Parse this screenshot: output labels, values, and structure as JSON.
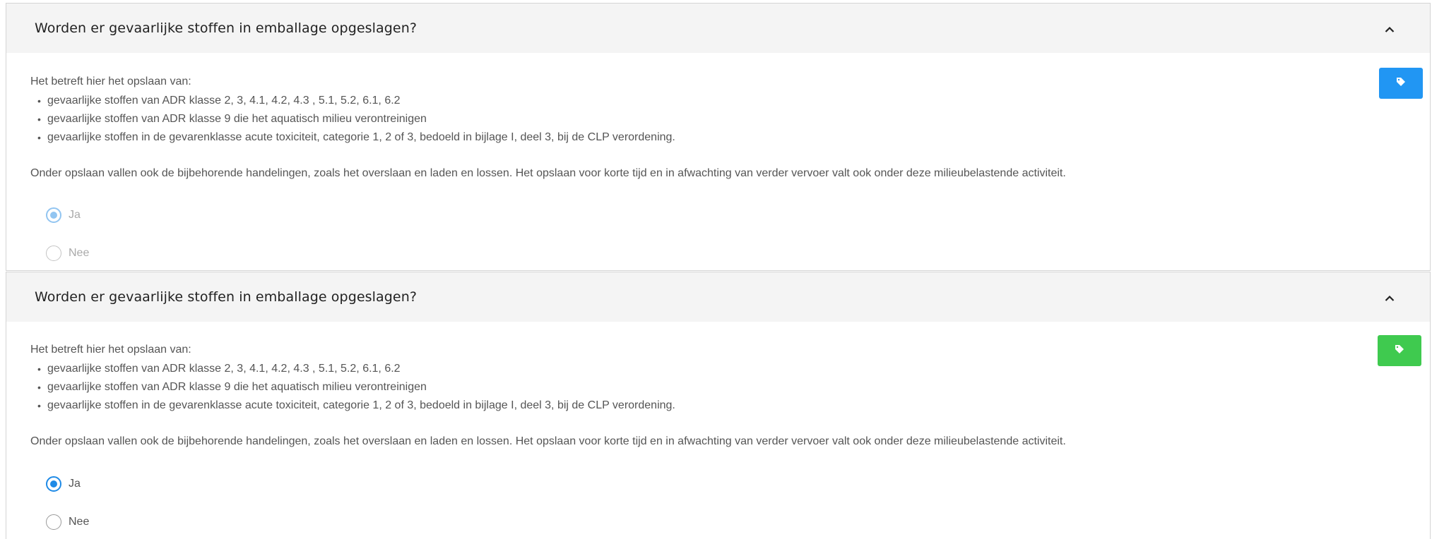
{
  "colors": {
    "tag_blue": "#2196f3",
    "tag_green": "#3fca4f",
    "radio_checked": "#1e8ae6",
    "radio_disabled_checked": "#92c5f1"
  },
  "icons": {
    "collapse": "chevron-up-icon",
    "tag": "tag-icon"
  },
  "panels": [
    {
      "title": "Worden er gevaarlijke stoffen in emballage opgeslagen?",
      "intro": "Het betreft hier het opslaan van:",
      "items": [
        "gevaarlijke stoffen van ADR klasse 2, 3, 4.1, 4.2, 4.3 , 5.1, 5.2, 6.1, 6.2",
        "gevaarlijke stoffen van ADR klasse 9 die het aquatisch milieu verontreinigen",
        "gevaarlijke stoffen in de gevarenklasse acute toxiciteit, categorie 1, 2 of 3, bedoeld in bijlage I, deel 3, bij de CLP verordening."
      ],
      "note": "Onder opslaan vallen ook de bijbehorende handelingen, zoals het overslaan en laden en lossen. Het opslaan voor korte tijd en in afwachting van verder vervoer valt ook onder deze milieubelastende activiteit.",
      "options": [
        {
          "label": "Ja",
          "checked": true
        },
        {
          "label": "Nee",
          "checked": false
        }
      ],
      "state": "disabled"
    },
    {
      "title": "Worden er gevaarlijke stoffen in emballage opgeslagen?",
      "intro": "Het betreft hier het opslaan van:",
      "items": [
        "gevaarlijke stoffen van ADR klasse 2, 3, 4.1, 4.2, 4.3 , 5.1, 5.2, 6.1, 6.2",
        "gevaarlijke stoffen van ADR klasse 9 die het aquatisch milieu verontreinigen",
        "gevaarlijke stoffen in de gevarenklasse acute toxiciteit, categorie 1, 2 of 3, bedoeld in bijlage I, deel 3, bij de CLP verordening."
      ],
      "note": "Onder opslaan vallen ook de bijbehorende handelingen, zoals het overslaan en laden en lossen. Het opslaan voor korte tijd en in afwachting van verder vervoer valt ook onder deze milieubelastende activiteit.",
      "options": [
        {
          "label": "Ja",
          "checked": true
        },
        {
          "label": "Nee",
          "checked": false
        }
      ],
      "state": "enabled"
    }
  ]
}
